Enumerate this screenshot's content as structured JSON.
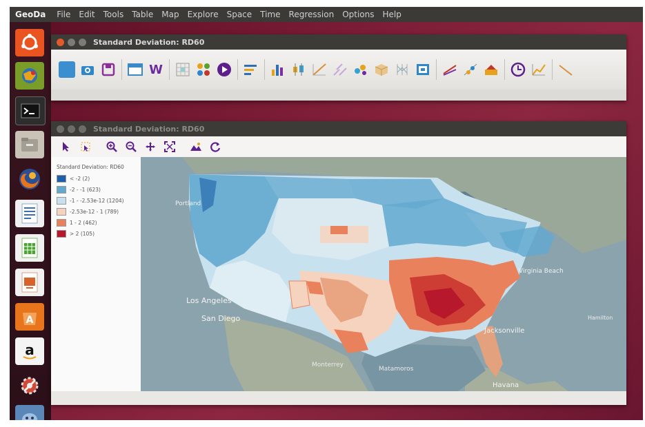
{
  "menubar": {
    "app": "GeoDa",
    "items": [
      "File",
      "Edit",
      "Tools",
      "Table",
      "Map",
      "Explore",
      "Space",
      "Time",
      "Regression",
      "Options",
      "Help"
    ]
  },
  "launcher": [
    "ubuntu-dash-icon",
    "geoda-icon",
    "terminal-icon",
    "files-icon",
    "firefox-icon",
    "writer-icon",
    "calc-icon",
    "impress-icon",
    "software-center-icon",
    "amazon-icon",
    "settings-icon",
    "geoda-db-icon"
  ],
  "toolbar_window": {
    "title": "Standard Deviation: RD60"
  },
  "toolbar_icons": [
    "open-icon",
    "camera-icon",
    "save-icon",
    "table-icon",
    "weights-icon",
    "grid-icon",
    "scatter-plugin-icon",
    "play-icon",
    "histogram-list-icon",
    "bar-chart-icon",
    "box-plot-icon",
    "scatter-icon",
    "scatter-matrix-icon",
    "bubble-icon",
    "cube-icon",
    "parallel-icon",
    "conditional-icon",
    "correlogram-icon",
    "moran-icon",
    "lisa-icon",
    "time-icon",
    "trend-icon",
    "regression-icon"
  ],
  "map_window": {
    "title": "Standard Deviation: RD60",
    "legend_title": "Standard Deviation: RD60",
    "legend": [
      {
        "label": "< -2 (2)",
        "color": "#1d5fa8"
      },
      {
        "label": "-2 - -1 (623)",
        "color": "#63a9cf"
      },
      {
        "label": "-1 - -2.53e-12 (1204)",
        "color": "#c8e1ee"
      },
      {
        "label": "-2.53e-12 - 1 (789)",
        "color": "#f6d3bf"
      },
      {
        "label": "1 - 2 (462)",
        "color": "#e9825c"
      },
      {
        "label": "> 2 (105)",
        "color": "#b8182b"
      }
    ],
    "map_labels": {
      "portland": "Portland",
      "los_angeles": "Los Angeles",
      "san_diego": "San Diego",
      "monterrey": "Monterrey",
      "matamoros": "Matamoros",
      "jacksonville": "Jacksonville",
      "havana": "Havana",
      "virginia_beach": "Virginia Beach",
      "hamilton": "Hamilton"
    }
  }
}
